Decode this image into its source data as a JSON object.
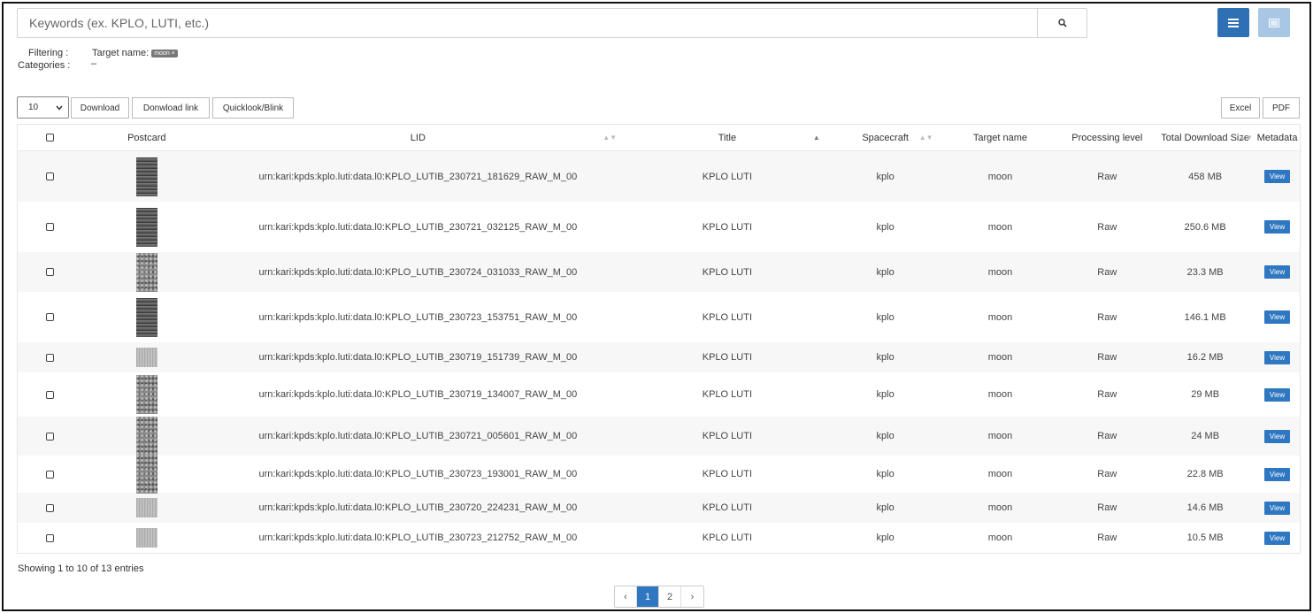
{
  "search": {
    "placeholder": "Keywords (ex. KPLO, LUTI, etc.)"
  },
  "filters": {
    "filtering_label": "Filtering :",
    "target_label": "Target name:",
    "target_chip": "moon ×",
    "categories_label": "Categories :",
    "categories_value": "–"
  },
  "toolbar": {
    "page_length": "10",
    "download": "Download",
    "download_link": "Donwload link",
    "quicklook": "Quicklook/Blink",
    "excel": "Excel",
    "pdf": "PDF"
  },
  "table": {
    "headers": {
      "postcard": "Postcard",
      "lid": "LID",
      "title": "Title",
      "spacecraft": "Spacecraft",
      "target": "Target name",
      "processing": "Processing level",
      "size": "Total Download Size",
      "metadata": "Metadata"
    },
    "view_label": "View",
    "rows": [
      {
        "lid": "urn:kari:kpds:kplo.luti:data.l0:KPLO_LUTIB_230721_181629_RAW_M_00",
        "title": "KPLO LUTI",
        "spacecraft": "kplo",
        "target": "moon",
        "processing": "Raw",
        "size": "458 MB"
      },
      {
        "lid": "urn:kari:kpds:kplo.luti:data.l0:KPLO_LUTIB_230721_032125_RAW_M_00",
        "title": "KPLO LUTI",
        "spacecraft": "kplo",
        "target": "moon",
        "processing": "Raw",
        "size": "250.6 MB"
      },
      {
        "lid": "urn:kari:kpds:kplo.luti:data.l0:KPLO_LUTIB_230724_031033_RAW_M_00",
        "title": "KPLO LUTI",
        "spacecraft": "kplo",
        "target": "moon",
        "processing": "Raw",
        "size": "23.3 MB"
      },
      {
        "lid": "urn:kari:kpds:kplo.luti:data.l0:KPLO_LUTIB_230723_153751_RAW_M_00",
        "title": "KPLO LUTI",
        "spacecraft": "kplo",
        "target": "moon",
        "processing": "Raw",
        "size": "146.1 MB"
      },
      {
        "lid": "urn:kari:kpds:kplo.luti:data.l0:KPLO_LUTIB_230719_151739_RAW_M_00",
        "title": "KPLO LUTI",
        "spacecraft": "kplo",
        "target": "moon",
        "processing": "Raw",
        "size": "16.2 MB"
      },
      {
        "lid": "urn:kari:kpds:kplo.luti:data.l0:KPLO_LUTIB_230719_134007_RAW_M_00",
        "title": "KPLO LUTI",
        "spacecraft": "kplo",
        "target": "moon",
        "processing": "Raw",
        "size": "29 MB"
      },
      {
        "lid": "urn:kari:kpds:kplo.luti:data.l0:KPLO_LUTIB_230721_005601_RAW_M_00",
        "title": "KPLO LUTI",
        "spacecraft": "kplo",
        "target": "moon",
        "processing": "Raw",
        "size": "24 MB"
      },
      {
        "lid": "urn:kari:kpds:kplo.luti:data.l0:KPLO_LUTIB_230723_193001_RAW_M_00",
        "title": "KPLO LUTI",
        "spacecraft": "kplo",
        "target": "moon",
        "processing": "Raw",
        "size": "22.8 MB"
      },
      {
        "lid": "urn:kari:kpds:kplo.luti:data.l0:KPLO_LUTIB_230720_224231_RAW_M_00",
        "title": "KPLO LUTI",
        "spacecraft": "kplo",
        "target": "moon",
        "processing": "Raw",
        "size": "14.6 MB"
      },
      {
        "lid": "urn:kari:kpds:kplo.luti:data.l0:KPLO_LUTIB_230723_212752_RAW_M_00",
        "title": "KPLO LUTI",
        "spacecraft": "kplo",
        "target": "moon",
        "processing": "Raw",
        "size": "10.5 MB"
      }
    ]
  },
  "footer": {
    "info": "Showing 1 to 10 of 13 entries",
    "prev": "‹",
    "pages": [
      "1",
      "2"
    ],
    "next": "›"
  },
  "colors": {
    "primary": "#2f6fb3",
    "primary_light": "#a9c6e4"
  },
  "icons": {
    "search": "search-icon",
    "list_view": "list-view-icon",
    "grid_view": "grid-view-icon"
  }
}
